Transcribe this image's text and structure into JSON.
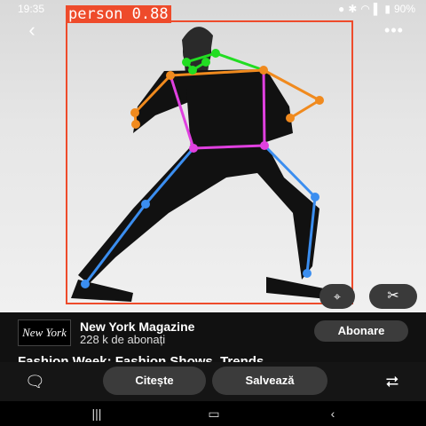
{
  "status_bar": {
    "time": "19:35",
    "battery": "90%",
    "indicators": [
      "dnd-icon",
      "bluetooth-icon",
      "wifi-icon",
      "volte-icon",
      "signal-icon",
      "battery-icon"
    ]
  },
  "detection": {
    "label": "person 0.88",
    "box_color": "#ee4b2b",
    "keypoint_colors": {
      "face": "#22dd22",
      "arms": "#f08a1e",
      "torso": "#e040e0",
      "legs": "#3b8ef0"
    }
  },
  "viewer": {
    "back_icon": "back-arrow-icon",
    "more_icon": "more-dots-icon",
    "lens_icon": "visual-search-icon",
    "scissors_icon": "scissors-icon"
  },
  "publisher": {
    "logo_text": "New York",
    "name": "New York Magazine",
    "subscribers": "228 k de abonați",
    "subscribe_label": "Abonare"
  },
  "headline": "Fashion Week: Fashion Shows, Trends",
  "actions": {
    "comment_icon": "comment-icon",
    "read_label": "Citește",
    "save_label": "Salvează",
    "share_icon": "share-icon"
  },
  "nav": {
    "recents_icon": "recents-icon",
    "home_icon": "home-icon",
    "back_icon": "nav-back-icon"
  }
}
